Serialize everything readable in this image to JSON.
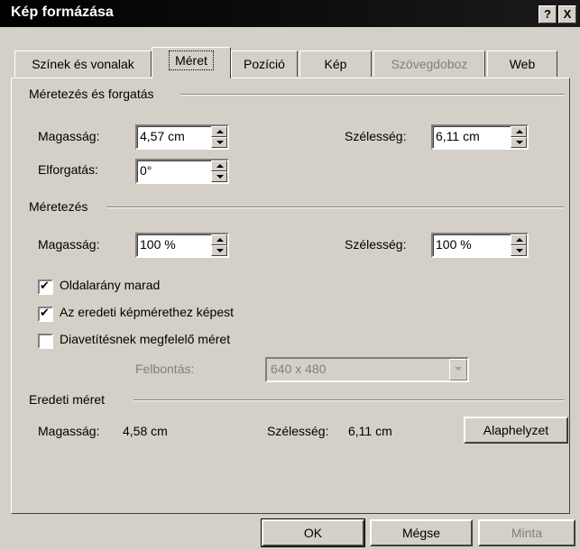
{
  "window": {
    "title": "Kép formázása",
    "help_label": "?",
    "close_label": "X"
  },
  "tabs": [
    {
      "label": "Színek és vonalak"
    },
    {
      "label": "Méret"
    },
    {
      "label": "Pozíció"
    },
    {
      "label": "Kép"
    },
    {
      "label": "Szövegdoboz"
    },
    {
      "label": "Web"
    }
  ],
  "group1": {
    "title": "Méretezés és forgatás",
    "height_label": "Magasság:",
    "height_value": "4,57 cm",
    "width_label": "Szélesség:",
    "width_value": "6,11 cm",
    "rotation_label": "Elforgatás:",
    "rotation_value": "0°"
  },
  "group2": {
    "title": "Méretezés",
    "height_label": "Magasság:",
    "height_value": "100 %",
    "width_label": "Szélesség:",
    "width_value": "100 %",
    "keep_aspect_label": "Oldalarány marad",
    "keep_aspect_checked": true,
    "relative_label": "Az eredeti képmérethez képest",
    "relative_checked": true,
    "slideshow_label": "Diavetítésnek megfelelő méret",
    "slideshow_checked": false,
    "resolution_label": "Felbontás:",
    "resolution_value": "640 x 480"
  },
  "group3": {
    "title": "Eredeti méret",
    "height_label": "Magasság:",
    "height_value": "4,58 cm",
    "width_label": "Szélesség:",
    "width_value": "6,11 cm",
    "reset_label": "Alaphelyzet"
  },
  "buttons": {
    "ok": "OK",
    "cancel": "Mégse",
    "preview": "Minta"
  }
}
